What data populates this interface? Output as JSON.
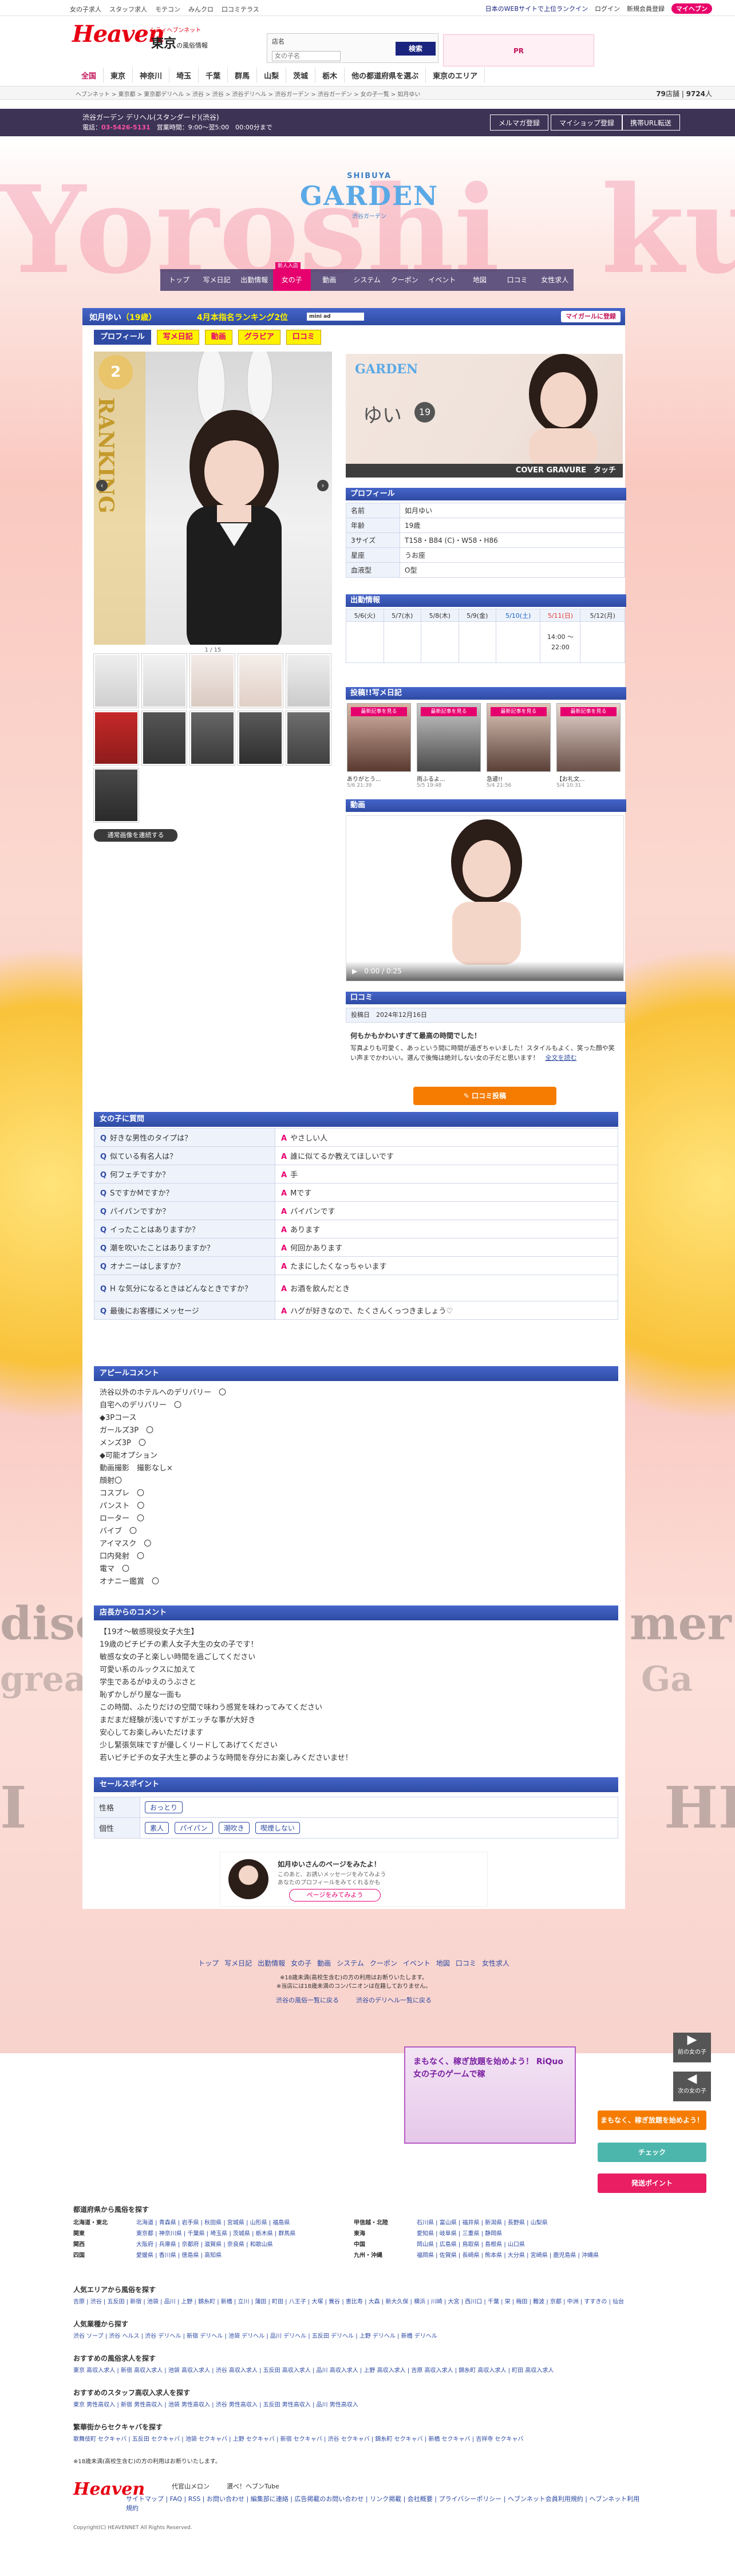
{
  "topbar": {
    "links": [
      "女の子求人",
      "スタッフ求人",
      "モテコン",
      "みんクロ",
      "口コミテラス"
    ],
    "right_text": "日本のWEBサイトで上位ランクイン",
    "login": "ログイン",
    "register": "新規会員登録",
    "mypage": "マイヘブン"
  },
  "header": {
    "logo": "Heaven",
    "logo_sub": "シティヘブンネット",
    "region": "東京",
    "region_sub": "の風俗情報",
    "search_label": "店名",
    "search_placeholder": "女の子名",
    "search_button": "検索",
    "banner_text": "PR"
  },
  "gnav": [
    "全国",
    "東京",
    "神奈川",
    "埼玉",
    "千葉",
    "群馬",
    "山梨",
    "茨城",
    "栃木",
    "他の都道府県を選ぶ",
    "東京のエリア"
  ],
  "crumb": {
    "text": "ヘブンネット > 東京都 > 東京都デリヘル > 渋谷 > 渋谷 > 渋谷デリヘル > 渋谷ガーデン > 渋谷ガーデン > 女の子一覧 > 如月ゆい",
    "count": "79",
    "count_unit": "店舗",
    "total": "9724",
    "total_unit": "人"
  },
  "shopbar": {
    "name": "渋谷ガーデン デリヘル(スタンダード)(渋谷)",
    "tel_label": "電話：",
    "tel": "03-5426-5131",
    "hours": "営業時間：9:00～翌5:00",
    "note": "00:00分まで",
    "mail": "メルマガ登録",
    "mypage": "マイショップ登録",
    "mobile": "携帯URL転送"
  },
  "bg": {
    "words": [
      "Yoroshi",
      "ku",
      "disc",
      "mer",
      "grea",
      "Ga",
      "I",
      "HH"
    ]
  },
  "shoplogo": {
    "top": "SHIBUYA",
    "main": "GARDEN",
    "sub": "渋谷ガーデン"
  },
  "shopnav": [
    {
      "label": "トップ"
    },
    {
      "label": "写メ日記"
    },
    {
      "label": "出勤情報"
    },
    {
      "label": "女の子",
      "badge": "新人入店"
    },
    {
      "label": "動画"
    },
    {
      "label": "システム"
    },
    {
      "label": "クーポン"
    },
    {
      "label": "イベント"
    },
    {
      "label": "地図"
    },
    {
      "label": "口コミ"
    },
    {
      "label": "女性求人"
    }
  ],
  "girl": {
    "name": "如月ゆい",
    "age": "（19歳）",
    "rank": "4月本指名ランキング2位",
    "mini": "mini ad",
    "reg": "マイガールに登録"
  },
  "tabs": [
    "プロフィール",
    "写メ日記",
    "動画",
    "グラビア",
    "口コミ"
  ],
  "photo": {
    "ranking": "RANKING",
    "rank_no": "2",
    "counter": "1 / 15",
    "autoplay": "通常画像を連続する"
  },
  "gravure": {
    "brand": "GARDEN",
    "name": "ゆい",
    "age": "19",
    "label": "COVER GRAVURE",
    "touch": "タッチ"
  },
  "profile": {
    "header": "プロフィール",
    "rows": [
      {
        "k": "名前",
        "v": "如月ゆい"
      },
      {
        "k": "年齢",
        "v": "19歳"
      },
      {
        "k": "3サイズ",
        "v": "T158・B84 (C)・W58・H86"
      },
      {
        "k": "星座",
        "v": "うお座"
      },
      {
        "k": "血液型",
        "v": "O型"
      }
    ]
  },
  "schedule": {
    "header": "出勤情報",
    "days": [
      "5/6(火)",
      "5/7(水)",
      "5/8(木)",
      "5/9(金)",
      "5/10(土)",
      "5/11(日)",
      "5/12(月)"
    ],
    "times": [
      "",
      "",
      "",
      "",
      "",
      "14:00 ～ 22:00",
      ""
    ]
  },
  "diary": {
    "header": "投稿!!写メ日記",
    "items": [
      {
        "label": "最新記事を見る",
        "title": "ありがとう...",
        "date": "5/6 21:39"
      },
      {
        "label": "最新記事を見る",
        "title": "雨ふるよ...",
        "date": "5/5 19:48"
      },
      {
        "label": "最新記事を見る",
        "title": "急遽!!",
        "date": "5/4 21:56"
      },
      {
        "label": "最新記事を見る",
        "title": "【お礼文...",
        "date": "5/4 10:31"
      }
    ]
  },
  "video": {
    "header": "動画",
    "time": "0:00 / 0:25"
  },
  "review": {
    "header": "口コミ",
    "date_label": "投稿日",
    "date": "2024年12月16日",
    "title": "何もかもかわいすぎて最高の時間でした！",
    "body": "写真よりも可愛く、あっという間に時間が過ぎちゃいました！スタイルもよく、笑った顔や笑い声までかわいい。選んで後悔は絶対しない女の子だと思います！",
    "more": "全文を読む",
    "button": "口コミ投稿"
  },
  "qa": {
    "header": "女の子に質問",
    "rows": [
      {
        "q": "好きな男性のタイプは？",
        "a": "やさしい人"
      },
      {
        "q": "似ている有名人は？",
        "a": "誰に似てるか教えてほしいです"
      },
      {
        "q": "何フェチですか？",
        "a": "手"
      },
      {
        "q": "SですかMですか？",
        "a": "Mです"
      },
      {
        "q": "パイパンですか？",
        "a": "パイパンです"
      },
      {
        "q": "イったことはありますか？",
        "a": "あります"
      },
      {
        "q": "潮を吹いたことはありますか？",
        "a": "何回かあります"
      },
      {
        "q": "オナニーはしますか？",
        "a": "たまにしたくなっちゃいます"
      },
      {
        "q": "H な気分になるときはどんなときですか？",
        "a": "お酒を飲んだとき"
      },
      {
        "q": "最後にお客様にメッセージ",
        "a": "ハグが好きなので、たくさんくっつきましょう♡"
      }
    ]
  },
  "appeal": {
    "header": "アピールコメント",
    "lines": [
      "渋谷以外のホテルへのデリバリー　〇",
      "自宅へのデリバリー　〇",
      "◆3Pコース",
      "ガールズ3P　〇",
      "メンズ3P　〇",
      "◆可能オプション",
      "動画撮影　撮影なし×",
      "顔射〇",
      "コスプレ　〇",
      "パンスト　〇",
      "ローター　〇",
      "バイブ　〇",
      "アイマスク　〇",
      "口内発射　〇",
      "電マ　〇",
      "オナニー鑑賞　〇"
    ]
  },
  "shopcomment": {
    "header": "店長からのコメント",
    "lines": [
      "【19才～敏感現役女子大生】",
      "19歳のピチピチの素人女子大生の女の子です！",
      "敏感な女の子と楽しい時間を過ごしてください",
      "可愛い系のルックスに加えて",
      "学生であるがゆえのうぶさと",
      "恥ずかしがり屋な一面も",
      "この時間、ふたりだけの空間で味わう感覚を味わってみてください",
      "まだまだ経験が浅いですがエッチな事が大好き",
      "安心してお楽しみいただけます",
      "少し緊張気味ですが優しくリードしてあげてください",
      "若いピチピチの女子大生と夢のような時間を存分にお楽しみくださいませ！"
    ]
  },
  "sales": {
    "header": "セールスポイント",
    "rows": [
      {
        "k": "性格",
        "chips": [
          "おっとり"
        ]
      },
      {
        "k": "個性",
        "chips": [
          "素人",
          "パイパン",
          "潮吹き",
          "喫煙しない"
        ]
      }
    ]
  },
  "recent": {
    "line1": "如月ゆいさんのページをみたよ！",
    "line2": "このあと、お誘いメッセージをみてみよう",
    "line3": "あなたのプロフィールをみてくれるかも",
    "button": "ページをみてみよう"
  },
  "bottomnav": {
    "links": [
      "トップ",
      "写メ日記",
      "出勤情報",
      "女の子",
      "動画",
      "システム",
      "クーポン",
      "イベント",
      "地図",
      "口コミ",
      "女性求人"
    ],
    "note1": "※18歳未満(高校生含む)の方の利用はお断りいたします。",
    "note2": "※当店には18歳未満のコンパニオンは在籍しておりません。",
    "link1": "渋谷の風俗一覧に戻る",
    "link2": "渋谷のデリヘル一覧に戻る"
  },
  "side": {
    "back": "前の女の子",
    "next": "次の女の子",
    "check": "チェック",
    "point": "発送ポイント",
    "banner": "まもなく、稼ぎ放題を始めよう！ RiQuo 女の子のゲームで稼"
  },
  "footer": {
    "region_title": "都道府県から風俗を探す",
    "region_rows": [
      {
        "k": "北海道・東北",
        "v": "北海道 | 青森県 | 岩手県 | 秋田県 | 宮城県 | 山形県 | 福島県"
      },
      {
        "k": "関東",
        "v": "東京都 | 神奈川県 | 千葉県 | 埼玉県 | 茨城県 | 栃木県 | 群馬県"
      },
      {
        "k": "関西",
        "v": "大阪府 | 兵庫県 | 京都府 | 滋賀県 | 奈良県 | 和歌山県"
      },
      {
        "k": "四国",
        "v": "愛媛県 | 香川県 | 徳島県 | 高知県"
      },
      {
        "k": "甲信越・北陸",
        "v": "石川県 | 富山県 | 福井県 | 新潟県 | 長野県 | 山梨県"
      },
      {
        "k": "東海",
        "v": "愛知県 | 岐阜県 | 三重県 | 静岡県"
      },
      {
        "k": "中国",
        "v": "岡山県 | 広島県 | 鳥取県 | 島根県 | 山口県"
      },
      {
        "k": "九州・沖縄",
        "v": "福岡県 | 佐賀県 | 長崎県 | 熊本県 | 大分県 | 宮崎県 | 鹿児島県 | 沖縄県"
      }
    ],
    "area_title": "人気エリアから風俗を探す",
    "area": "吉原 | 渋谷 | 五反田 | 新宿 | 池袋 | 品川 | 上野 | 錦糸町 | 新橋 | 立川 | 蒲田 | 町田 | 八王子 | 大塚 | 鶯谷 | 恵比寿 | 大森 | 新大久保 | 横浜 | 川崎 | 大宮 | 西川口 | 千葉 | 栄 | 梅田 | 難波 | 京都 | 中洲 | すすきの | 仙台",
    "genre_title": "人気業種から探す",
    "genre": "渋谷 ソープ | 渋谷 ヘルス | 渋谷 デリヘル | 新宿 デリヘル | 池袋 デリヘル | 品川 デリヘル | 五反田 デリヘル | 上野 デリヘル | 新橋 デリヘル",
    "job_title": "おすすめの風俗求人を探す",
    "job": "東京 高収入求人 | 新宿 高収入求人 | 池袋 高収入求人 | 渋谷 高収入求人 | 五反田 高収入求人 | 品川 高収入求人 | 上野 高収入求人 | 吉原 高収入求人 | 錦糸町 高収入求人 | 町田 高収入求人",
    "staff_title": "おすすめのスタッフ高収入求人を探す",
    "staff": "東京 男性高収入 | 新宿 男性高収入 | 池袋 男性高収入 | 渋谷 男性高収入 | 五反田 男性高収入 | 品川 男性高収入",
    "sekkyaku_title": "繁華街からセクキャバを探す",
    "sekkyaku": "歌舞伎町 セクキャバ | 五反田 セクキャバ | 池袋 セクキャバ | 上野 セクキャバ | 新宿 セクキャバ | 渋谷 セクキャバ | 錦糸町 セクキャバ | 新橋 セクキャバ | 吉祥寺 セクキャバ",
    "note": "※18歳未満(高校生含む)の方の利用はお断りいたします。",
    "logo": "Heaven",
    "links": "サイトマップ | FAQ | RSS | お問い合わせ | 編集部に連絡 | 広告掲載のお問い合わせ | リンク掲載 | 会社概要 | プライバシーポリシー | ヘブンネット会員利用規約 | ヘブンネット利用規約",
    "copy": "Copyright(C) HEAVENNET All Rights Reserved.",
    "melon": "代官山メロン",
    "tube": "選べ！ヘブンTube"
  }
}
